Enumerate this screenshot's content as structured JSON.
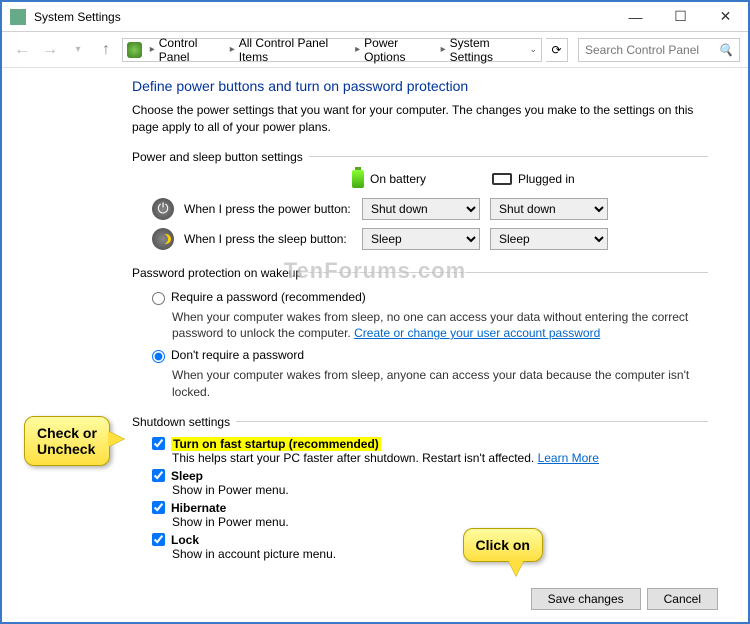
{
  "window": {
    "title": "System Settings"
  },
  "breadcrumb": {
    "items": [
      "Control Panel",
      "All Control Panel Items",
      "Power Options",
      "System Settings"
    ]
  },
  "search": {
    "placeholder": "Search Control Panel"
  },
  "page": {
    "heading": "Define power buttons and turn on password protection",
    "desc": "Choose the power settings that you want for your computer. The changes you make to the settings on this page apply to all of your power plans."
  },
  "section1": {
    "legend": "Power and sleep button settings",
    "col_battery": "On battery",
    "col_plugged": "Plugged in",
    "power_label": "When I press the power button:",
    "sleep_label": "When I press the sleep button:",
    "power_battery": "Shut down",
    "power_plugged": "Shut down",
    "sleep_battery": "Sleep",
    "sleep_plugged": "Sleep"
  },
  "section2": {
    "legend": "Password protection on wakeup",
    "opt1": "Require a password (recommended)",
    "opt1_desc": "When your computer wakes from sleep, no one can access your data without entering the correct password to unlock the computer.",
    "opt1_link": "Create or change your user account password",
    "opt2": "Don't require a password",
    "opt2_desc": "When your computer wakes from sleep, anyone can access your data because the computer isn't locked.",
    "selected": "opt2"
  },
  "section3": {
    "legend": "Shutdown settings",
    "fast": {
      "label": "Turn on fast startup (recommended)",
      "desc_a": "This helps start your PC faster after shutdown. Restart isn't affected.",
      "link": "Learn More",
      "checked": true
    },
    "sleep": {
      "label": "Sleep",
      "desc": "Show in Power menu.",
      "checked": true
    },
    "hibernate": {
      "label": "Hibernate",
      "desc": "Show in Power menu.",
      "checked": true
    },
    "lock": {
      "label": "Lock",
      "desc": "Show in account picture menu.",
      "checked": true
    }
  },
  "buttons": {
    "save": "Save changes",
    "cancel": "Cancel"
  },
  "callouts": {
    "c1a": "Check or",
    "c1b": "Uncheck",
    "c2": "Click on"
  },
  "watermark": "TenForums.com"
}
